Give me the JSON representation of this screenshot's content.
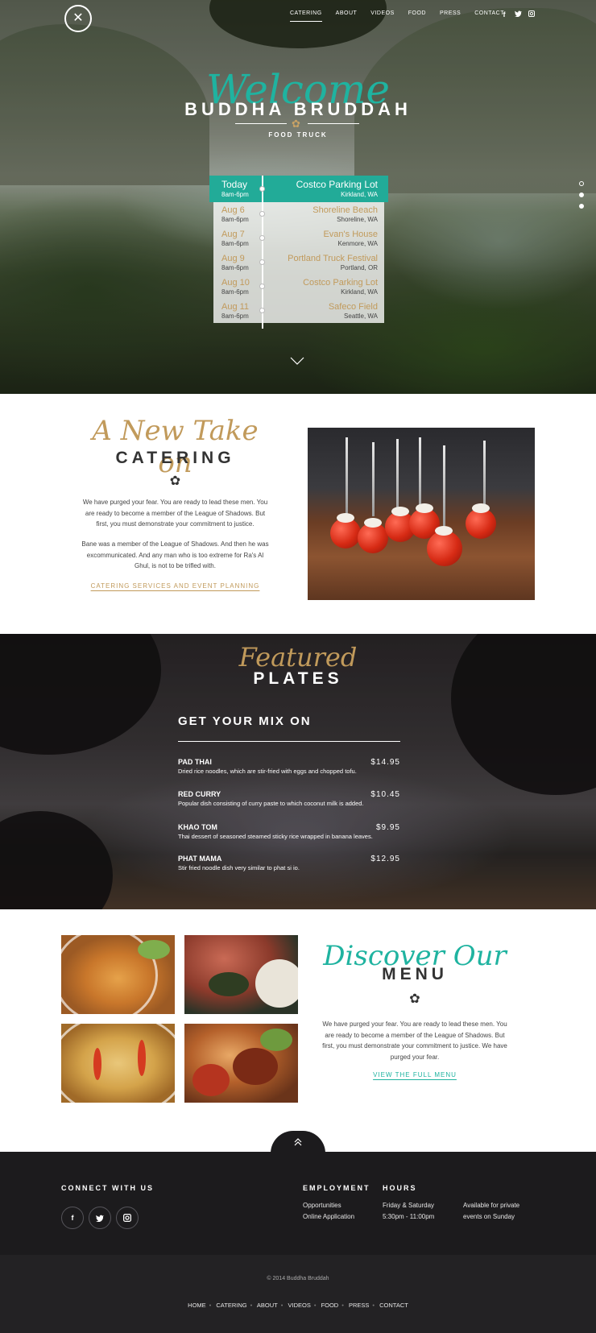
{
  "nav": {
    "logo_icon": "crossed-utensils-logo",
    "items": [
      "CATERING",
      "ABOUT",
      "VIDEOS",
      "FOOD",
      "PRESS",
      "CONTACT"
    ],
    "active": "CATERING",
    "social": [
      {
        "icon": "facebook-icon",
        "glyph": "f"
      },
      {
        "icon": "twitter-icon",
        "glyph": "t"
      },
      {
        "icon": "instagram-icon",
        "glyph": "◘"
      }
    ]
  },
  "hero": {
    "script": "Welcome",
    "title": "BUDDHA BRUDDAH",
    "flower": "✿",
    "subtitle": "FOOD TRUCK",
    "schedule": [
      {
        "date": "Today",
        "time": "8am-6pm",
        "place": "Costco Parking Lot",
        "city": "Kirkland, WA"
      },
      {
        "date": "Aug 6",
        "time": "8am-6pm",
        "place": "Shoreline Beach",
        "city": "Shoreline, WA"
      },
      {
        "date": "Aug 7",
        "time": "8am-6pm",
        "place": "Evan's House",
        "city": "Kenmore, WA"
      },
      {
        "date": "Aug 9",
        "time": "8am-6pm",
        "place": "Portland Truck Festival",
        "city": "Portland, OR"
      },
      {
        "date": "Aug 10",
        "time": "8am-6pm",
        "place": "Costco Parking Lot",
        "city": "Kirkland, WA"
      },
      {
        "date": "Aug 11",
        "time": "8am-6pm",
        "place": "Safeco Field",
        "city": "Seattle, WA"
      }
    ]
  },
  "catering": {
    "script": "A New Take on",
    "title": "CATERING",
    "flower": "✿",
    "p1": "We have purged your fear. You are ready to lead these men. You are ready to become a member of the League of Shadows. But first, you must demonstrate your commitment to justice.",
    "p2": "Bane was a member of the League of Shadows. And then he was excommunicated. And any man who is too extreme for Ra's Al Ghul, is not to be trifled with.",
    "link": "CATERING SERVICES AND EVENT PLANNING"
  },
  "plates": {
    "script": "Featured",
    "title": "PLATES",
    "heading": "GET YOUR MIX ON",
    "items": [
      {
        "name": "PAD THAI",
        "price": "$14.95",
        "desc": "Dried rice noodles, which are stir-fried with eggs and chopped tofu."
      },
      {
        "name": "RED CURRY",
        "price": "$10.45",
        "desc": "Popular dish consisting of curry paste to which coconut milk is added."
      },
      {
        "name": "KHAO TOM",
        "price": "$9.95",
        "desc": "Thai dessert of seasoned steamed sticky rice wrapped in banana leaves."
      },
      {
        "name": "PHAT MAMA",
        "price": "$12.95",
        "desc": "Stir fried noodle dish very similar to phat si io."
      }
    ]
  },
  "menu": {
    "script": "Discover Our",
    "title": "MENU",
    "flower": "✿",
    "p": "We have purged your fear. You are ready to lead these men. You are ready to become a member of the League of Shadows. But first, you must demonstrate your commitment to justice. We have purged your fear.",
    "link": "VIEW THE FULL MENU"
  },
  "footer": {
    "connect_heading": "CONNECT WITH US",
    "social": [
      {
        "icon": "facebook-icon",
        "glyph": "f"
      },
      {
        "icon": "twitter-icon",
        "glyph": "t"
      },
      {
        "icon": "instagram-icon",
        "glyph": "◘"
      }
    ],
    "employment_heading": "EMPLOYMENT",
    "employment_links": [
      "Opportunities",
      "Online Application"
    ],
    "hours_heading": "HOURS",
    "hours_days": [
      "Friday & Saturday",
      "5:30pm - 11:00pm"
    ],
    "hours_note": [
      "Available for private",
      "events on Sunday"
    ],
    "copyright": "© 2014 Buddha Bruddah",
    "nav": [
      "HOME",
      "CATERING",
      "ABOUT",
      "VIDEOS",
      "FOOD",
      "PRESS",
      "CONTACT"
    ]
  },
  "colors": {
    "teal": "#22ab98",
    "gold": "#c19a5b",
    "dark": "#1c1b1d"
  }
}
